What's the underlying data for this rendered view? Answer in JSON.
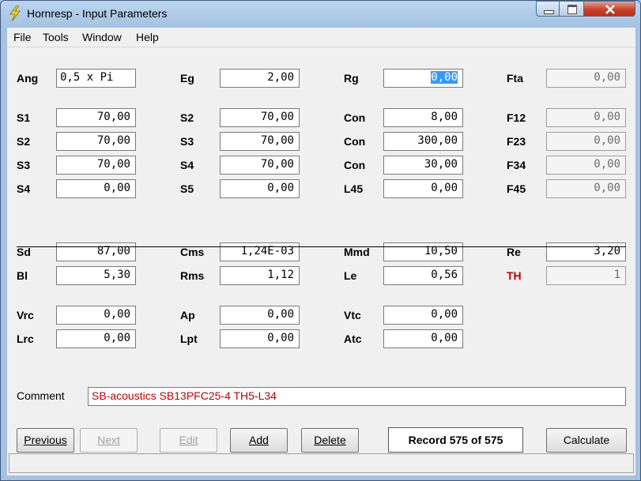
{
  "window": {
    "title": "Hornresp - Input Parameters",
    "icon": "lightning-bolt-icon"
  },
  "menu": [
    "File",
    "Tools",
    "Window",
    "Help"
  ],
  "rows": {
    "r1": [
      {
        "label": "Ang",
        "value": "0,5 x Pi"
      },
      {
        "label": "Eg",
        "value": "2,00"
      },
      {
        "label": "Rg",
        "value": "0,00",
        "selected": true
      },
      {
        "label": "Fta",
        "value": "0,00",
        "disabled": true
      }
    ],
    "r2": [
      {
        "label": "S1",
        "value": "70,00"
      },
      {
        "label": "S2",
        "value": "70,00"
      },
      {
        "label": "Con",
        "value": "8,00"
      },
      {
        "label": "F12",
        "value": "0,00",
        "disabled": true
      }
    ],
    "r3": [
      {
        "label": "S2",
        "value": "70,00"
      },
      {
        "label": "S3",
        "value": "70,00"
      },
      {
        "label": "Con",
        "value": "300,00"
      },
      {
        "label": "F23",
        "value": "0,00",
        "disabled": true
      }
    ],
    "r4": [
      {
        "label": "S3",
        "value": "70,00"
      },
      {
        "label": "S4",
        "value": "70,00"
      },
      {
        "label": "Con",
        "value": "30,00"
      },
      {
        "label": "F34",
        "value": "0,00",
        "disabled": true
      }
    ],
    "r5": [
      {
        "label": "S4",
        "value": "0,00"
      },
      {
        "label": "S5",
        "value": "0,00"
      },
      {
        "label": "L45",
        "value": "0,00"
      },
      {
        "label": "F45",
        "value": "0,00",
        "disabled": true
      }
    ],
    "r6": [
      {
        "label": "Sd",
        "value": "87,00"
      },
      {
        "label": "Cms",
        "value": "1,24E-03"
      },
      {
        "label": "Mmd",
        "value": "10,50"
      },
      {
        "label": "Re",
        "value": "3,20"
      }
    ],
    "r7": [
      {
        "label": "Bl",
        "value": "5,30"
      },
      {
        "label": "Rms",
        "value": "1,12"
      },
      {
        "label": "Le",
        "value": "0,56"
      },
      {
        "label": "TH",
        "value": "1",
        "disabled": true
      }
    ],
    "r8": [
      {
        "label": "Vrc",
        "value": "0,00"
      },
      {
        "label": "Ap",
        "value": "0,00"
      },
      {
        "label": "Vtc",
        "value": "0,00"
      }
    ],
    "r9": [
      {
        "label": "Lrc",
        "value": "0,00"
      },
      {
        "label": "Lpt",
        "value": "0,00"
      },
      {
        "label": "Atc",
        "value": "0,00"
      }
    ]
  },
  "comment": {
    "label": "Comment",
    "value": "SB-acoustics SB13PFC25-4 TH5-L34"
  },
  "buttons": {
    "previous": "Previous",
    "next": "Next",
    "edit": "Edit",
    "add": "Add",
    "delete": "Delete",
    "calculate": "Calculate"
  },
  "record": "Record 575 of 575",
  "colors": {
    "selection": "#3399ff",
    "th_label": "#c00000",
    "comment_text": "#c00000",
    "close_button": "#c8432b"
  }
}
